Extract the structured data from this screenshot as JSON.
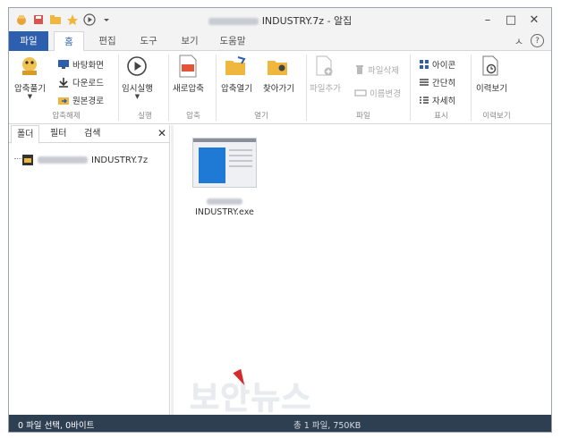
{
  "window": {
    "title_suffix": "INDUSTRY.7z - 알집",
    "minimize": "–",
    "maximize": "□",
    "close": "✕"
  },
  "tabs": {
    "file": "파일",
    "home": "홈",
    "edit": "편집",
    "tools": "도구",
    "view": "보기",
    "help": "도움말",
    "collapse": "ㅅ",
    "help_icon": "?"
  },
  "ribbon": {
    "extract": "압축풀기",
    "desktop": "바탕화면",
    "download": "다운로드",
    "original_path": "원본경로",
    "group_extract": "압축해제",
    "temp_run": "임시실행",
    "group_run": "실행",
    "new_archive": "새로압축",
    "group_compress": "압축",
    "open_archive": "압축열기",
    "find": "찾아가기",
    "group_open": "열기",
    "add_file": "파일추가",
    "delete_file": "파일삭제",
    "rename": "이름변경",
    "group_file": "파일",
    "view_icons": "아이콘",
    "view_simple": "간단히",
    "view_details": "자세히",
    "group_display": "표시",
    "history": "이력보기",
    "group_history": "이력보기"
  },
  "leftpane": {
    "tab_folder": "폴더",
    "tab_filter": "필터",
    "tab_search": "검색",
    "close": "✕",
    "tree_root": "INDUSTRY.7z"
  },
  "mainpane": {
    "file_name": "INDUSTRY.exe"
  },
  "status": {
    "selection": "0 파일 선택, 0바이트",
    "total": "총 1 파일, 750KB"
  },
  "watermark": "보안뉴스",
  "colors": {
    "file_tab": "#2d5fae",
    "statusbar": "#2f3f52",
    "accent_blue": "#1f7ad6"
  }
}
